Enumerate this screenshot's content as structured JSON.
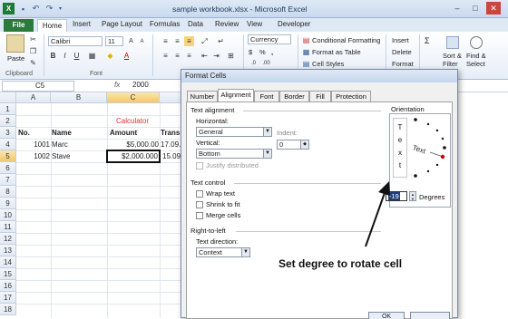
{
  "window": {
    "title": "sample workbook.xlsx - Microsoft Excel"
  },
  "ribbon_tabs": [
    "File",
    "Home",
    "Insert",
    "Page Layout",
    "Formulas",
    "Data",
    "Review",
    "View",
    "Developer"
  ],
  "ribbon": {
    "paste": "Paste",
    "clipboard": "Clipboard",
    "font_name": "Calibri",
    "font_size": "11",
    "font_group": "Font",
    "number_format": "Currency",
    "currency_symbol": "$",
    "percent": "%",
    "comma": ",",
    "conditional_formatting": "Conditional Formatting",
    "format_as_table": "Format as Table",
    "cell_styles": "Cell Styles",
    "insert": "Insert",
    "delete": "Delete",
    "format": "Format",
    "sort_filter": "Sort &",
    "filter": "Filter",
    "find_select": "Find &",
    "select": "Select",
    "sum": "Σ"
  },
  "formula_bar": {
    "name_box": "C5",
    "fx": "fx",
    "value": "2000"
  },
  "grid": {
    "columns": [
      "A",
      "B",
      "C"
    ],
    "rows": [
      "1",
      "2",
      "3",
      "4",
      "5",
      "6",
      "7",
      "8",
      "9",
      "10",
      "11",
      "12",
      "13",
      "14",
      "15",
      "16",
      "17",
      "18"
    ],
    "calculator_title": "Calculator",
    "headers": {
      "no": "No.",
      "name": "Name",
      "amount": "Amount",
      "trans": "Trans"
    },
    "row4": {
      "no": "1001",
      "name": "Marc",
      "amount": "$5,000.00",
      "trans": "17.09."
    },
    "row5": {
      "no": "1002",
      "name": "Stave",
      "amount": "$2,000.000",
      "trans": "15.09."
    }
  },
  "dialog": {
    "title": "Format Cells",
    "tabs": [
      "Number",
      "Alignment",
      "Font",
      "Border",
      "Fill",
      "Protection"
    ],
    "text_alignment": "Text alignment",
    "horizontal_label": "Horizontal:",
    "horizontal_value": "General",
    "indent_label": "Indent:",
    "indent_value": "0",
    "vertical_label": "Vertical:",
    "vertical_value": "Bottom",
    "justify_distributed": "Justify distributed",
    "text_control": "Text control",
    "wrap_text": "Wrap text",
    "shrink_to_fit": "Shrink to fit",
    "merge_cells": "Merge cells",
    "rtl": "Right-to-left",
    "text_direction_label": "Text direction:",
    "text_direction_value": "Context",
    "orientation": "Orientation",
    "vertical_text": [
      "T",
      "e",
      "x",
      "t"
    ],
    "rotated_text": "Text",
    "degrees_value": "-19",
    "degrees_label": "Degrees",
    "ok_label": "OK"
  },
  "annotation": "Set degree to rotate cell"
}
